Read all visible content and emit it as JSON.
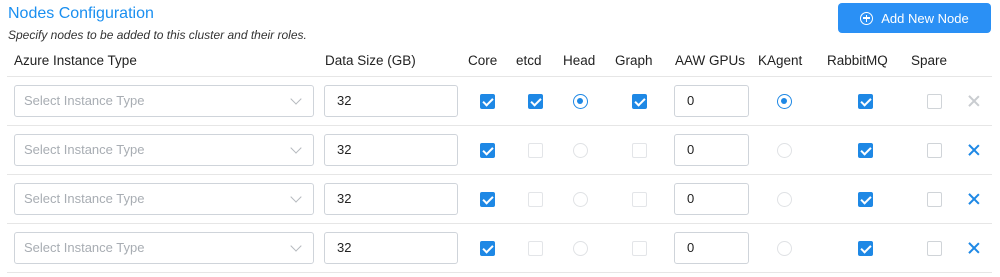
{
  "header": {
    "title": "Nodes Configuration",
    "subtitle": "Specify nodes to be added to this cluster and their roles.",
    "add_button_label": "Add New Node"
  },
  "columns": {
    "instance_type": "Azure Instance Type",
    "data_size": "Data Size (GB)",
    "core": "Core",
    "etcd": "etcd",
    "head": "Head",
    "graph": "Graph",
    "aaw_gpus": "AAW GPUs",
    "kagent": "KAgent",
    "rabbitmq": "RabbitMQ",
    "spare": "Spare"
  },
  "rows": [
    {
      "instance_placeholder": "Select Instance Type",
      "data_size": "32",
      "core": true,
      "etcd": true,
      "head": true,
      "graph": true,
      "aaw_gpus": "0",
      "kagent": true,
      "rabbitmq": true,
      "spare": false,
      "removable": false
    },
    {
      "instance_placeholder": "Select Instance Type",
      "data_size": "32",
      "core": true,
      "etcd": false,
      "head": false,
      "graph": false,
      "aaw_gpus": "0",
      "kagent": false,
      "rabbitmq": true,
      "spare": false,
      "removable": true
    },
    {
      "instance_placeholder": "Select Instance Type",
      "data_size": "32",
      "core": true,
      "etcd": false,
      "head": false,
      "graph": false,
      "aaw_gpus": "0",
      "kagent": false,
      "rabbitmq": true,
      "spare": false,
      "removable": true
    },
    {
      "instance_placeholder": "Select Instance Type",
      "data_size": "32",
      "core": true,
      "etcd": false,
      "head": false,
      "graph": false,
      "aaw_gpus": "0",
      "kagent": false,
      "rabbitmq": true,
      "spare": false,
      "removable": true
    }
  ],
  "colors": {
    "accent": "#1e88e5",
    "title": "#1a8ff0",
    "button": "#2a90f5"
  },
  "icons": {
    "add": "plus-circle-icon",
    "remove": "close-icon",
    "dropdown": "chevron-down-icon"
  }
}
